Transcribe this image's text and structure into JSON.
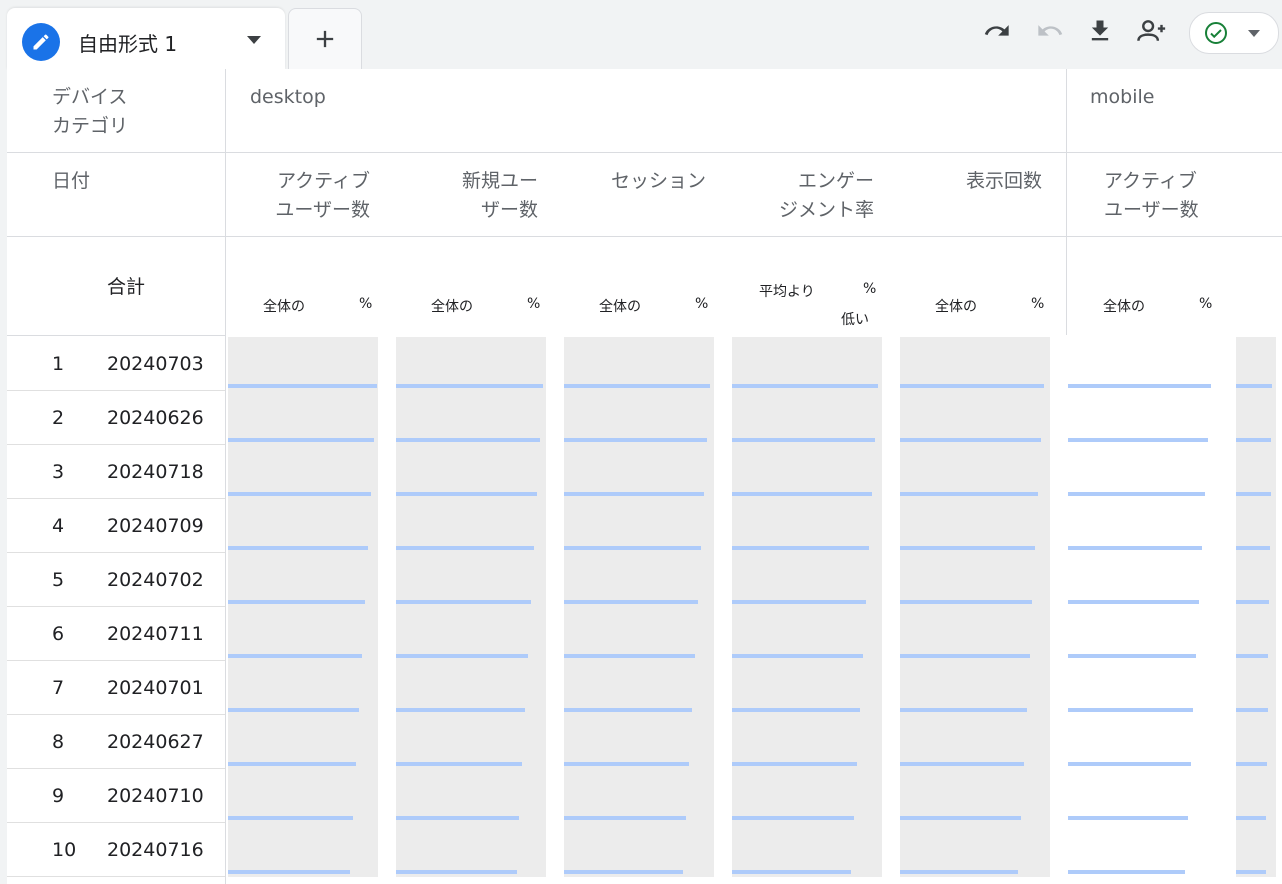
{
  "tab": {
    "title": "自由形式 1"
  },
  "toolbar": {
    "icons": [
      "undo-icon",
      "redo-icon",
      "download-icon",
      "share-user-icon",
      "check-circle-icon",
      "chevron-down-icon"
    ]
  },
  "table": {
    "dimension_header": "デバイス\nカテゴリ",
    "row_header": "日付",
    "total_label": "合計",
    "groups": [
      "desktop",
      "mobile"
    ],
    "metric_headers": [
      "アクティブ\nユーザー数",
      "新規ユー\nザー数",
      "セッション",
      "エンゲー\nジメント率",
      "表示回数",
      "アクティブ\nユーザー数"
    ],
    "total_sub": {
      "share": "全体の",
      "percent": "%",
      "avg_prefix": "平均より",
      "avg_suffix": "低い"
    },
    "rows": [
      {
        "index": "1",
        "date": "20240703"
      },
      {
        "index": "2",
        "date": "20240626"
      },
      {
        "index": "3",
        "date": "20240718"
      },
      {
        "index": "4",
        "date": "20240709"
      },
      {
        "index": "5",
        "date": "20240702"
      },
      {
        "index": "6",
        "date": "20240711"
      },
      {
        "index": "7",
        "date": "20240701"
      },
      {
        "index": "8",
        "date": "20240627"
      },
      {
        "index": "9",
        "date": "20240710"
      },
      {
        "index": "10",
        "date": "20240716"
      }
    ]
  },
  "colors": {
    "accent": "#1a73e8",
    "bar": "#aecbfa",
    "check": "#188038"
  }
}
